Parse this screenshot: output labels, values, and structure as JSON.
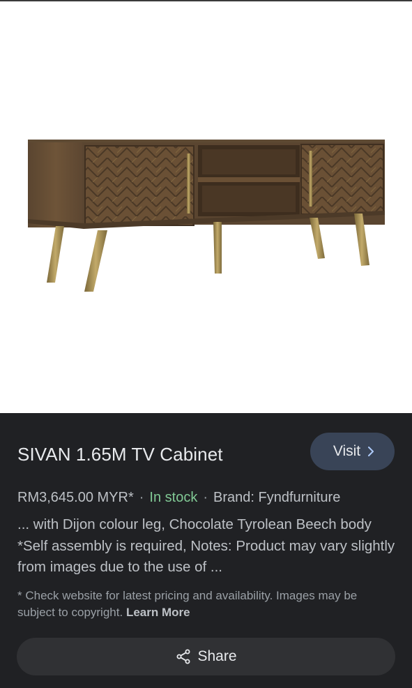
{
  "product": {
    "title": "SIVAN 1.65M TV Cabinet",
    "image_alt": "Wooden TV cabinet with herringbone doors and brass legs"
  },
  "visit_button": {
    "label": "Visit",
    "icon": "chevron-right-icon"
  },
  "meta": {
    "price": "RM3,645.00 MYR*",
    "separator": "·",
    "stock": "In stock",
    "brand": "Brand: Fyndfurniture"
  },
  "description": "... with Dijon colour leg, Chocolate Tyrolean Beech body *Self assembly is required, Notes: Product may vary slightly from images due to the use of ...",
  "disclaimer": {
    "text": "* Check website for latest pricing and availability. Images may be subject to copyright.",
    "learn_more": "Learn More"
  },
  "share_button": {
    "label": "Share",
    "icon": "share-icon"
  },
  "colors": {
    "panel_bg": "#202124",
    "visit_bg": "#394457",
    "share_bg": "#303134",
    "in_stock": "#81c995"
  }
}
